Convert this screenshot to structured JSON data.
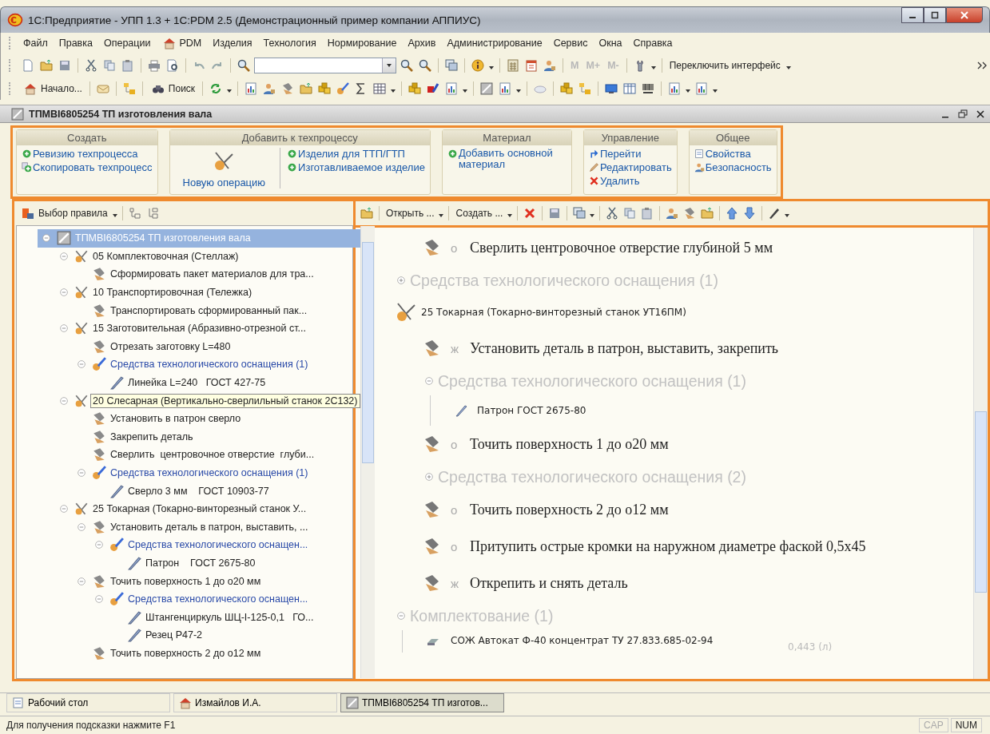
{
  "window": {
    "title": "1С:Предприятие - УПП 1.3 + 1С:PDM 2.5 (Демонстрационный пример компании АППИУС)"
  },
  "menu": [
    {
      "label": "Файл",
      "kind": "text"
    },
    {
      "label": "Правка",
      "kind": "text"
    },
    {
      "label": "Операции",
      "kind": "text"
    },
    {
      "label": "PDM",
      "kind": "icon"
    },
    {
      "label": "Изделия",
      "kind": "text"
    },
    {
      "label": "Технология",
      "kind": "text"
    },
    {
      "label": "Нормирование",
      "kind": "text"
    },
    {
      "label": "Архив",
      "kind": "text"
    },
    {
      "label": "Администрирование",
      "kind": "text"
    },
    {
      "label": "Сервис",
      "kind": "text"
    },
    {
      "label": "Окна",
      "kind": "text"
    },
    {
      "label": "Справка",
      "kind": "text"
    }
  ],
  "toolbar_1": {
    "memory_buttons": [
      {
        "label": "M",
        "disabled": true
      },
      {
        "label": "M+",
        "disabled": true
      },
      {
        "label": "M-",
        "disabled": true
      }
    ],
    "switch_interface": "Переключить интерфейс"
  },
  "toolbar_2": {
    "start": "Начало...",
    "search": "Поиск"
  },
  "document": {
    "title": "ТПМВI6805254 ТП изготовления вала"
  },
  "command_panel": {
    "groups": [
      {
        "title": "Создать",
        "items": [
          {
            "kind": "link",
            "label": "Ревизию техпроцесса"
          },
          {
            "kind": "link",
            "label": "Скопировать техпроцесс"
          }
        ]
      },
      {
        "title": "Добавить к техпроцессу",
        "items": [
          {
            "kind": "large",
            "label": "Новую операцию"
          },
          {
            "kind": "link",
            "label": "Изделия для ТТП/ГТП"
          },
          {
            "kind": "link",
            "label": "Изготавливаемое изделие"
          }
        ]
      },
      {
        "title": "Материал",
        "items": [
          {
            "kind": "link",
            "label": "Добавить основной материал"
          }
        ]
      },
      {
        "title": "Управление",
        "items": [
          {
            "kind": "link",
            "label": "Перейти"
          },
          {
            "kind": "link",
            "label": "Редактировать"
          },
          {
            "kind": "link",
            "label": "Удалить"
          }
        ]
      },
      {
        "title": "Общее",
        "items": [
          {
            "kind": "link",
            "label": "Свойства"
          },
          {
            "kind": "link",
            "label": "Безопасность"
          }
        ]
      }
    ]
  },
  "tree_panel": {
    "rule_button": "Выбор правила",
    "tree": [
      {
        "kind": "root",
        "label": "ТПМВI6805254 ТП изготовления вала",
        "selected": true,
        "expanded": true,
        "children": [
          {
            "kind": "operation",
            "label": "05 Комплектовочная (Стеллаж)",
            "selected": false,
            "expanded": true,
            "children": [
              {
                "kind": "transition",
                "label": "Сформировать пакет материалов для тра...",
                "selected": false
              }
            ]
          },
          {
            "kind": "operation",
            "label": "10 Транспортировочная (Тележка)",
            "selected": false,
            "expanded": true,
            "children": [
              {
                "kind": "transition",
                "label": "Транспортировать сформированный пак...",
                "selected": false
              }
            ]
          },
          {
            "kind": "operation",
            "label": "15 Заготовительная (Абразивно-отрезной ст...",
            "selected": false,
            "expanded": true,
            "children": [
              {
                "kind": "transition",
                "label": "Отрезать заготовку L=480",
                "selected": false
              },
              {
                "kind": "tooling",
                "label": "Средства технологического оснащения (1)",
                "selected": false,
                "expanded": true,
                "children": [
                  {
                    "kind": "tool",
                    "label": "Линейка L=240   ГОСТ 427-75",
                    "selected": false
                  }
                ]
              }
            ]
          },
          {
            "kind": "operation",
            "label": "20 Слесарная (Вертикально-сверлильный станок 2С132)",
            "selected": false,
            "hovered": true,
            "expanded": true,
            "children": [
              {
                "kind": "transition",
                "label": "Установить в патрон сверло",
                "selected": false
              },
              {
                "kind": "transition",
                "label": "Закрепить деталь",
                "selected": false
              },
              {
                "kind": "transition",
                "label": "Сверлить  центровочное отверстие  глуби...",
                "selected": false
              },
              {
                "kind": "tooling",
                "label": "Средства технологического оснащения (1)",
                "selected": false,
                "expanded": true,
                "children": [
                  {
                    "kind": "tool",
                    "label": "Сверло 3 мм    ГОСТ 10903-77",
                    "selected": false
                  }
                ]
              }
            ]
          },
          {
            "kind": "operation",
            "label": "25 Токарная (Токарно-винторезный станок У...",
            "selected": false,
            "expanded": true,
            "children": [
              {
                "kind": "transition",
                "label": "Установить деталь в патрон, выставить, ...",
                "selected": false,
                "expanded": true,
                "children": [
                  {
                    "kind": "tooling",
                    "label": "Средства технологического оснащен...",
                    "selected": false,
                    "expanded": true,
                    "children": [
                      {
                        "kind": "tool",
                        "label": "Патрон    ГОСТ 2675-80",
                        "selected": false
                      }
                    ]
                  }
                ]
              },
              {
                "kind": "transition",
                "label": "Точить поверхность 1 до о20 мм",
                "selected": false,
                "expanded": true,
                "children": [
                  {
                    "kind": "tooling",
                    "label": "Средства технологического оснащен...",
                    "selected": false,
                    "expanded": true,
                    "children": [
                      {
                        "kind": "tool",
                        "label": "Штангенциркуль ШЦ-I-125-0,1   ГО...",
                        "selected": false
                      },
                      {
                        "kind": "tool",
                        "label": "Резец Р47-2",
                        "selected": false
                      }
                    ]
                  }
                ]
              },
              {
                "kind": "transition",
                "label": "Точить поверхность 2 до о12 мм",
                "selected": false
              }
            ]
          }
        ]
      }
    ]
  },
  "document_panel": {
    "toolbar": {
      "open": "Открыть ...",
      "create": "Создать ..."
    },
    "content": [
      {
        "kind": "transition",
        "mark": "о",
        "text": "Сверлить центровочное отверстие глубиной 5 мм"
      },
      {
        "kind": "group",
        "title": "Средства технологического оснащения (1)",
        "expanded": false
      },
      {
        "kind": "operation",
        "text": "25 Токарная (Токарно-винторезный станок УТ16ПМ)",
        "children": [
          {
            "kind": "transition",
            "mark": "ж",
            "text": "Установить деталь в патрон, выставить, закрепить"
          },
          {
            "kind": "group",
            "title": "Средства технологического оснащения (1)",
            "expanded": true,
            "children": [
              {
                "kind": "tool",
                "text": "Патрон ГОСТ 2675-80"
              }
            ]
          },
          {
            "kind": "transition",
            "mark": "о",
            "text": "Точить поверхность 1 до о20 мм"
          },
          {
            "kind": "group",
            "title": "Средства технологического оснащения (2)",
            "expanded": false
          },
          {
            "kind": "transition",
            "mark": "о",
            "text": "Точить поверхность 2 до о12 мм"
          },
          {
            "kind": "transition",
            "mark": "о",
            "text": "Притупить острые кромки на наружном диаметре фаской 0,5х45"
          },
          {
            "kind": "transition",
            "mark": "ж",
            "text": "Открепить и снять деталь"
          }
        ]
      },
      {
        "kind": "group",
        "title": "Комплектование (1)",
        "expanded": true,
        "children": [
          {
            "kind": "material",
            "text": "СОЖ Автокат Ф-40 концентрат ТУ 27.833.685-02-94",
            "quantity": "0,443 (л)"
          }
        ]
      }
    ]
  },
  "taskbar": [
    {
      "label": "Рабочий стол",
      "selected": false
    },
    {
      "label": "Измайлов И.А.",
      "selected": false
    },
    {
      "label": "ТПМВI6805254 ТП изготов...",
      "selected": true
    }
  ],
  "status_bar": {
    "hint": "Для получения подсказки нажмите F1",
    "indicators": [
      {
        "label": "CAP",
        "on": false
      },
      {
        "label": "NUM",
        "on": true
      }
    ]
  }
}
